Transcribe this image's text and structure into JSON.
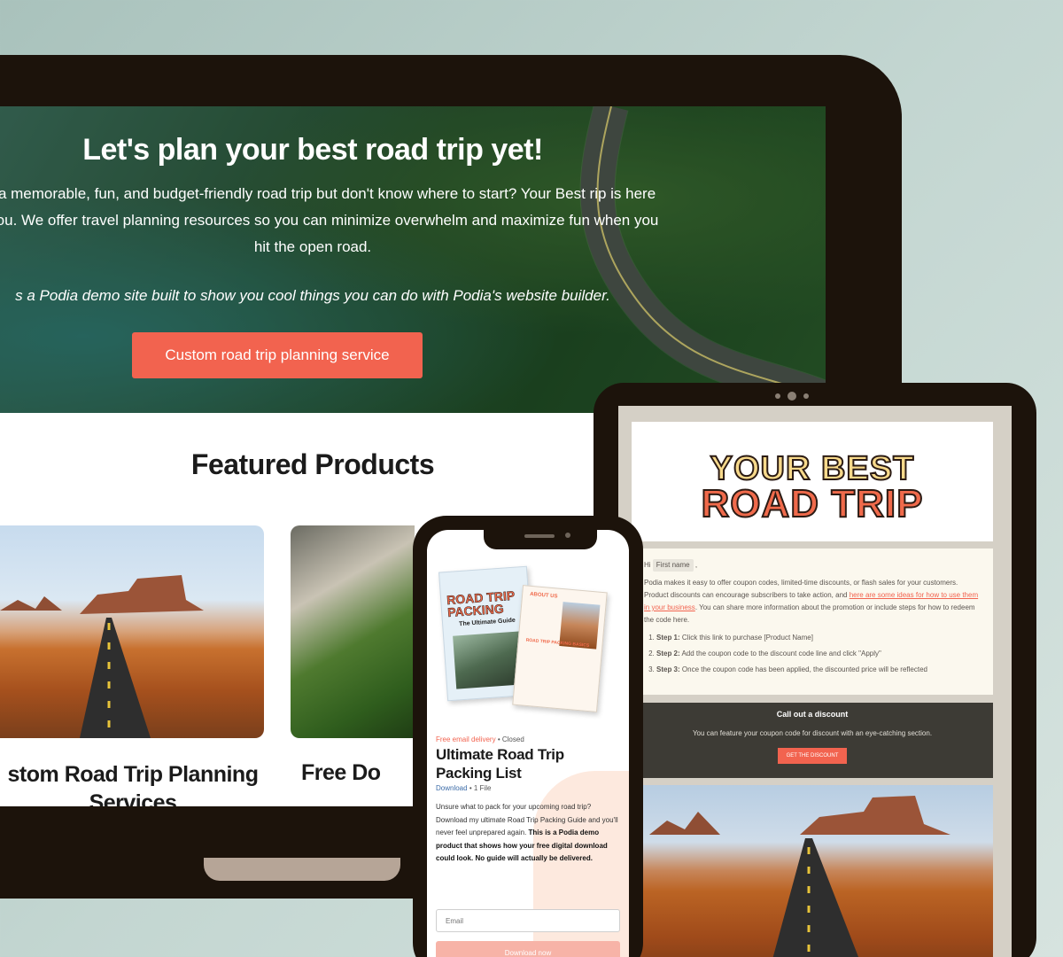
{
  "laptop": {
    "hero": {
      "title": "Let's plan your best road trip yet!",
      "description": "ake a memorable, fun, and budget-friendly road trip but don't know where to start? Your Best rip is here for you. We offer travel planning resources so you can minimize overwhelm and maximize fun when you hit the open road.",
      "note": "s a Podia demo site built to show you cool things you can do with Podia's website builder.",
      "cta_label": "Custom road trip planning service"
    },
    "featured": {
      "title": "Featured Products",
      "cards": [
        {
          "title": "stom Road Trip Planning Services"
        },
        {
          "title": "Free Do"
        }
      ]
    }
  },
  "tablet": {
    "logo": {
      "line1": "YOUR BEST",
      "line2": "ROAD TRIP"
    },
    "greeting": "Hi",
    "merge_tag": "First name",
    "intro": "Podia makes it easy to offer coupon codes, limited-time discounts, or flash sales for your customers. Product discounts can encourage subscribers to take action, and",
    "link_text": "here are some ideas for how to use them in your business",
    "intro_end": ". You can share more information about the promotion or include steps for how to redeem the code here.",
    "steps": [
      {
        "label": "Step 1:",
        "text": "Click this link to purchase [Product Name]"
      },
      {
        "label": "Step 2:",
        "text": "Add the coupon code to the discount code line and click \"Apply\""
      },
      {
        "label": "Step 3:",
        "text": "Once the coupon code has been applied, the discounted price will be reflected"
      }
    ],
    "discount": {
      "title": "Call out a discount",
      "text": "You can feature your coupon code for discount with an eye-catching section.",
      "button": "GET THE DISCOUNT"
    }
  },
  "phone": {
    "book1": {
      "title": "ROAD TRIP PACKING",
      "subtitle": "The Ultimate Guide"
    },
    "book2": {
      "title": "ABOUT US",
      "subtitle": "ROAD TRIP PACKING BASICS"
    },
    "status": "Free email delivery",
    "status2": "Closed",
    "title": "Ultimate Road Trip Packing List",
    "meta": "Download",
    "meta2": "1 File",
    "description": "Unsure what to pack for your upcoming road trip? Download my ultimate Road Trip Packing Guide and you'll never feel unprepared again.",
    "description_bold": "This is a Podia demo product that shows how your free digital download could look. No guide will actually be delivered.",
    "email_placeholder": "Email",
    "download_label": "Download now"
  }
}
